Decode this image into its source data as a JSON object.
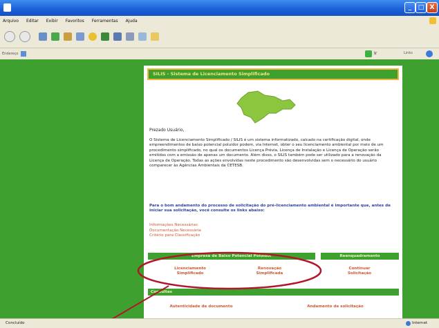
{
  "window": {
    "minimize_glyph": "_",
    "maximize_glyph": "□",
    "close_glyph": "X"
  },
  "menu": {
    "items": [
      "Arquivo",
      "Editar",
      "Exibir",
      "Favoritos",
      "Ferramentas",
      "Ajuda"
    ]
  },
  "toolbar": {
    "icons": [
      "back-icon",
      "forward-icon",
      "stop-icon",
      "refresh-icon",
      "home-icon",
      "search-icon",
      "favorites-icon",
      "history-icon",
      "mail-icon",
      "print-icon",
      "edit-icon",
      "folder-icon"
    ]
  },
  "address": {
    "label": "Endereço",
    "go_label": "Ir",
    "links_label": "Links"
  },
  "page": {
    "header": "SILIS - Sistema de Licenciamento Simplificado",
    "greeting": "Prezado Usuário,",
    "intro": "O Sistema de Licenciamento Simplificado / SILIS é um sistema informatizado, calcado na certificação digital, onde empreendimentos de baixo potencial poluidor podem, via Internet, obter o seu licenciamento ambiental por meio de um procedimento simplificado, no qual os documentos Licença Prévia, Licença de Instalação e Licença de Operação serão emitidos com a emissão de apenas um documento. Além disso, o SILIS também pode ser utilizado para a renovação da Licença de Operação. Todas as ações envolvidas neste procedimento são desenvolvidas sem o necessário do usuário comparecer às Agências Ambientais da CETESB.",
    "recommend": "Para o bom andamento do processo de solicitação do pré-licenciamento ambiental é importante que, antes de iniciar sua solicitação, você consulte os links abaixo:",
    "links": [
      "Informações Necessárias",
      "Documentação Necessária",
      "Critério para Classificação"
    ],
    "bars": {
      "empresa": "Empresa de Baixo Potencial Poluidor",
      "reenquadramento": "Reenquadramento",
      "consultas": "Consultas"
    },
    "options": {
      "licenciamento": "Licenciamento Simplificado",
      "renovacao": "Renovação Simplificada",
      "continuar": "Continuar Solicitação",
      "autenticidade": "Autenticidade de documento",
      "andamento": "Andamento de solicitação"
    }
  },
  "status": {
    "left": "Concluído",
    "right": "Internet"
  },
  "colors": {
    "page_green": "#3ea02e",
    "header_border": "#f2b53a",
    "link_orange": "#d05830",
    "annotation_red": "#b0182a",
    "map_green": "#8cc63f"
  }
}
